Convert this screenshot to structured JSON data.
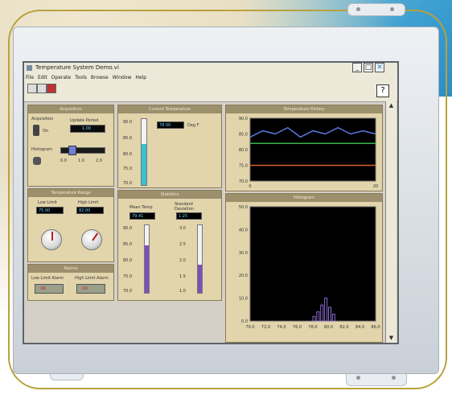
{
  "window": {
    "title": "Temperature System Demo.vi",
    "minimize_label": "_",
    "restore_label": "□",
    "close_label": "✕"
  },
  "menu": [
    "File",
    "Edit",
    "Operate",
    "Tools",
    "Browse",
    "Window",
    "Help"
  ],
  "toolbar": {
    "help_label": "?"
  },
  "panels": {
    "acquisition": {
      "title": "Acquisition",
      "acquisition_label": "Acquisition",
      "update_period_label": "Update Period",
      "update_period_value": "1.00",
      "histogram_label": "Histogram",
      "histogram_scale": [
        "0.0",
        "1.0",
        "2.0"
      ],
      "status_label": "On"
    },
    "temperature_range": {
      "title": "Temperature Range",
      "low_label": "Low Limit",
      "low_value": "75.00",
      "high_label": "High Limit",
      "high_value": "82.00"
    },
    "alarms": {
      "title": "Alarms",
      "low_label": "Low Limit Alarm",
      "high_label": "High Limit Alarm",
      "low_status": "OK",
      "high_status": "OK"
    },
    "current_temp": {
      "title": "Current Temperature",
      "value": "78.00",
      "unit": "Deg F",
      "scale": [
        "90.0",
        "85.0",
        "80.0",
        "75.0",
        "70.0"
      ]
    },
    "statistics": {
      "title": "Statistics",
      "mean_label": "Mean Temp",
      "mean_value": "79.41",
      "std_label": "Standard Deviation",
      "std_value": "1.25",
      "mean_scale": [
        "90.0",
        "85.0",
        "80.0",
        "75.0",
        "70.0"
      ],
      "std_scale": [
        "3.0",
        "2.5",
        "2.0",
        "1.5",
        "1.0"
      ]
    },
    "temp_history": {
      "title": "Temperature History",
      "y_ticks": [
        "90.0",
        "85.0",
        "80.0",
        "75.0",
        "70.0"
      ],
      "x_ticks": [
        "0",
        "20"
      ]
    },
    "histogram": {
      "title": "Histogram",
      "y_ticks": [
        "50.0",
        "40.0",
        "30.0",
        "20.0",
        "10.0",
        "0.0"
      ],
      "x_ticks": [
        "70.0",
        "72.0",
        "74.0",
        "76.0",
        "78.0",
        "80.0",
        "82.0",
        "84.0",
        "86.0"
      ]
    }
  },
  "chart_data": [
    {
      "type": "line",
      "title": "Temperature History",
      "x": [
        0,
        2,
        4,
        6,
        8,
        10,
        12,
        14,
        16,
        18,
        20
      ],
      "series": [
        {
          "values": [
            84,
            86,
            85,
            87,
            84,
            86,
            85,
            87,
            85,
            86,
            85
          ],
          "color": "#5a7be0"
        },
        {
          "values": [
            82,
            82,
            82,
            82,
            82,
            82,
            82,
            82,
            82,
            82,
            82
          ],
          "color": "#39b54a"
        },
        {
          "values": [
            75,
            75,
            75,
            75,
            75,
            75,
            75,
            75,
            75,
            75,
            75
          ],
          "color": "#d86030"
        }
      ],
      "ylim": [
        70,
        90
      ],
      "xlim": [
        0,
        20
      ]
    },
    {
      "type": "bar",
      "title": "Histogram",
      "x": [
        78.0,
        78.5,
        79.0,
        79.5,
        80.0,
        80.5
      ],
      "values": [
        2,
        4,
        7,
        10,
        6,
        3
      ],
      "ylim": [
        0,
        50
      ],
      "xlim": [
        70,
        86
      ],
      "color": "#8a6ad0"
    }
  ]
}
